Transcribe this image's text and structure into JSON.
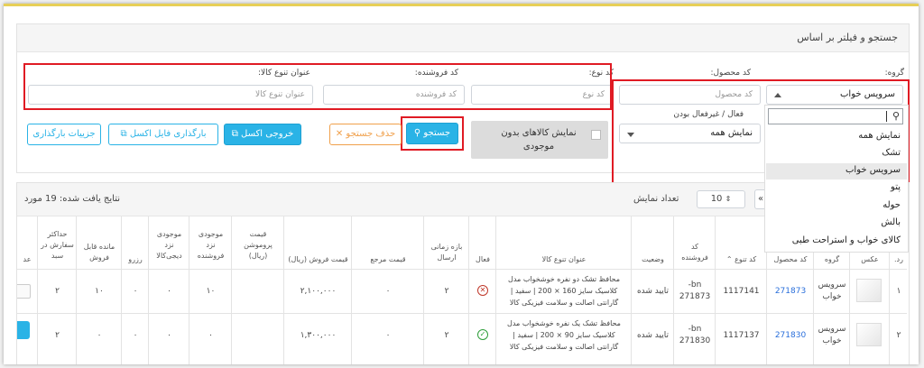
{
  "filters": {
    "title": "جستجو و فیلتر بر اساس",
    "group": {
      "label": "گروه:",
      "value": "سرویس خواب"
    },
    "product_code": {
      "label": "کد محصول:",
      "placeholder": "کد محصول"
    },
    "type_code": {
      "label": "کد نوع:",
      "placeholder": "کد نوع"
    },
    "seller_code": {
      "label": "کد فروشنده:",
      "placeholder": "کد فروشنده"
    },
    "type_title": {
      "label": "عنوان تنوع کالا:",
      "placeholder": "عنوان تنوع کالا"
    },
    "active": {
      "label": "فعال / غیرفعال بودن",
      "value": "نمایش همه"
    },
    "show_no_stock": {
      "label": "نمایش کالاهای بدون موجودی"
    }
  },
  "group_options": [
    "نمایش همه",
    "تشک",
    "سرویس خواب",
    "پتو",
    "حوله",
    "بالش",
    "کالای خواب و استراحت طبی"
  ],
  "actions": {
    "search": "جستجو",
    "clear": "حذف جستجو",
    "excel_out": "خروجی اکسل",
    "excel_upload": "بارگذاری فایل اکسل",
    "upload_details": "جزییات بارگذاری"
  },
  "results": {
    "found": "نتایج یافت شده: 19 مورد",
    "page_size_label": "تعداد نمایش",
    "page_size": "10"
  },
  "table": {
    "headers": {
      "row": "رد.",
      "image": "عکس",
      "group": "گروه",
      "product_code": "کد محصول",
      "type_code": "کد تنوع",
      "seller_code_1": "کد",
      "seller_code_2": "فروشنده",
      "status": "وضعیت",
      "title": "عنوان تنوع کالا",
      "active": "فعال",
      "ship_1": "بازه زمانی",
      "ship_2": "ارسال",
      "ref_price": "قیمت مرجع",
      "sale_price": "قیمت فروش (ریال)",
      "promo_1": "قیمت",
      "promo_2": "پروموشن",
      "promo_3": "(ریال)",
      "seller_stock_1": "موجودی",
      "seller_stock_2": "نزد",
      "seller_stock_3": "فروشنده",
      "dk_stock_1": "موجودی",
      "dk_stock_2": "نزد",
      "dk_stock_3": "دیجی‌کالا",
      "reserve": "رزرو",
      "remaining_1": "مانده قابل",
      "remaining_2": "فروش",
      "max_order_1": "حداکثر",
      "max_order_2": "سفارش در",
      "max_order_3": "سبد",
      "extra": "عد"
    },
    "rows": [
      {
        "row": "۱",
        "group_1": "سرویس",
        "group_2": "خواب",
        "product_code": "271873",
        "type_code": "1117141",
        "seller_code_1": "bn-",
        "seller_code_2": "271873",
        "status": "تایید شده",
        "title_1": "محافظ تشک دو نفره خوشخواب مدل",
        "title_2": "کلاسیک سایز 160 × 200 | سفید |",
        "title_3": "گارانتی اصالت و سلامت فیزیکی کالا",
        "active": false,
        "ship": "۲",
        "ref_price": "۰",
        "sale_price": "۲,۱۰۰,۰۰۰",
        "promo": "",
        "seller_stock": "۱۰",
        "dk_stock": "۰",
        "reserve": "۰",
        "remaining": "۱۰",
        "max_order": "۲"
      },
      {
        "row": "۲",
        "group_1": "سرویس",
        "group_2": "خواب",
        "product_code": "271830",
        "type_code": "1117137",
        "seller_code_1": "bn-",
        "seller_code_2": "271830",
        "status": "تایید شده",
        "title_1": "محافظ تشک یک نفره خوشخواب مدل",
        "title_2": "کلاسیک سایز 90 × 200 | سفید |",
        "title_3": "گارانتی اصالت و سلامت فیزیکی کالا",
        "active": true,
        "ship": "۲",
        "ref_price": "۰",
        "sale_price": "۱,۳۰۰,۰۰۰",
        "promo": "",
        "seller_stock": "۰",
        "dk_stock": "۰",
        "reserve": "۰",
        "remaining": "۰",
        "max_order": "۲"
      }
    ]
  },
  "colors": {
    "primary": "#2ab3e6",
    "danger": "#e01b24",
    "warning": "#f0a04b",
    "success": "#2e9e3a",
    "link": "#2a6fdb"
  }
}
